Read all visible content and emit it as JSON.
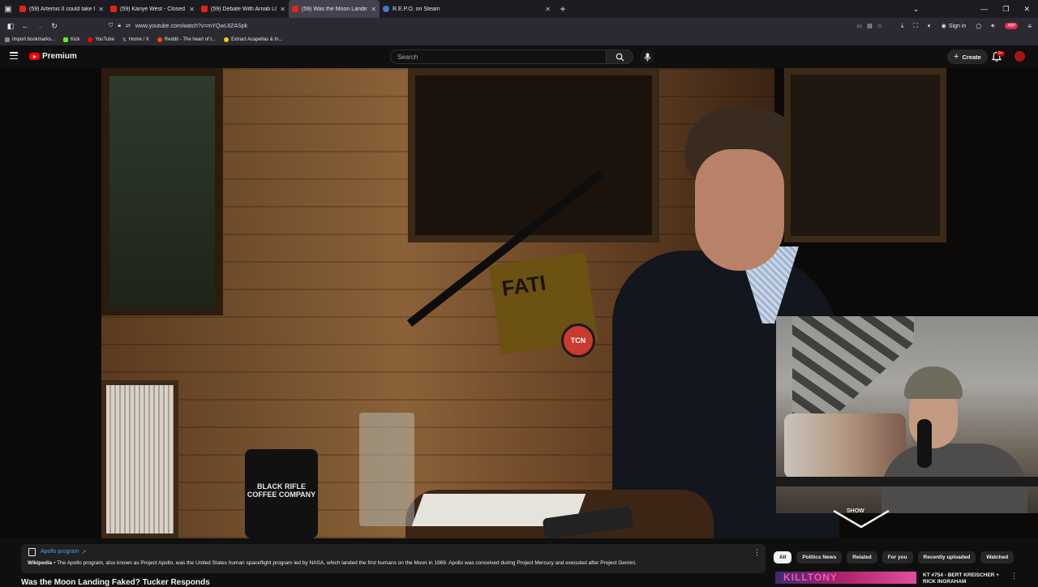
{
  "browser": {
    "tabs": [
      {
        "title": "(59) Artemis II could take huma",
        "active": false
      },
      {
        "title": "(59) Kanye West - Closed O",
        "active": false
      },
      {
        "title": "(59) Debate With Arnab LIVE: A",
        "active": false
      },
      {
        "title": "(59) Was the Moon Landing Fa",
        "active": true
      },
      {
        "title": "R.E.P.O. on Steam",
        "active": false
      }
    ],
    "url": "www.youtube.com/watch?v=mYQwL8ZASpk",
    "sign_in": "Sign in",
    "bookmarks": [
      {
        "label": "Import bookmarks...",
        "color": "#8a8a8a"
      },
      {
        "label": "Kick",
        "color": "#53fc18"
      },
      {
        "label": "YouTube",
        "color": "#ff0000"
      },
      {
        "label": "Home / X",
        "color": "#e7e7ea"
      },
      {
        "label": "Reddit - The heart of t...",
        "color": "#ff4500"
      },
      {
        "label": "Extract Acapellas & In...",
        "color": "#f5c518"
      }
    ]
  },
  "youtube": {
    "logo_text": "Premium",
    "search_placeholder": "Search",
    "create_label": "Create",
    "notification_count": "9+",
    "video": {
      "sign_text": "FATI",
      "mic_logo": "TCN",
      "mug_text": "BLACK RIFLE COFFEE COMPANY",
      "overlay_badge": "SHOW"
    },
    "info_panel": {
      "title": "Apollo program",
      "source": "Wikipedia",
      "text": " • The Apollo program, also known as Project Apollo, was the United States human spaceflight program led by NASA, which landed the first humans on the Moon in 1969. Apollo was conceived during Project Mercury and executed after Project Gemini."
    },
    "video_title": "Was the Moon Landing Faked? Tucker Responds",
    "chips": [
      "All",
      "Politics News",
      "Related",
      "For you",
      "Recently uploaded",
      "Watched"
    ],
    "recommendation": {
      "thumb_text": "KILLTONY",
      "title": "KT #754 - BERT KREISCHER + RICK INGRAHAM"
    }
  }
}
